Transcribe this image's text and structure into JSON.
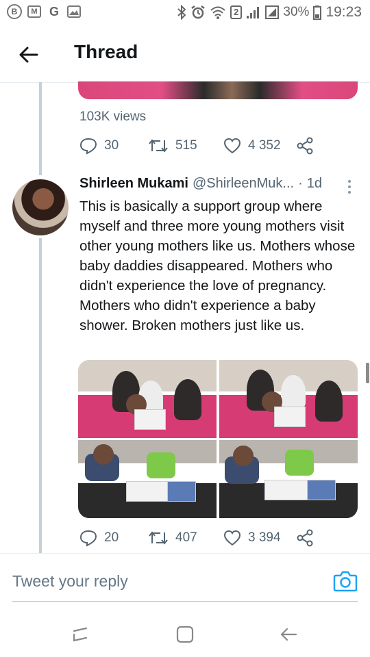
{
  "status_bar": {
    "left_icons": [
      "B",
      "M",
      "G",
      "image-icon"
    ],
    "sim_badge": "2",
    "battery": "30%",
    "time": "19:23"
  },
  "header": {
    "title": "Thread"
  },
  "previous_tweet": {
    "views": "103K views",
    "replies": "30",
    "retweets": "515",
    "likes": "4 352"
  },
  "tweet": {
    "name": "Shirleen Mukami",
    "handle": "@ShirleenMuk...",
    "dot": "·",
    "time": "1d",
    "text": "This is basically a support group where myself and three more young mothers visit other young mothers like us. Mothers whose baby daddies disappeared. Mothers who didn't experience the love of pregnancy. Mothers who didn't experience a baby shower. Broken mothers just like us.",
    "replies": "20",
    "retweets": "407",
    "likes": "3 394"
  },
  "reply": {
    "placeholder": "Tweet your reply"
  },
  "colors": {
    "accent": "#1da1f2",
    "muted": "#536471",
    "thread_line": "#c4cfd6"
  }
}
